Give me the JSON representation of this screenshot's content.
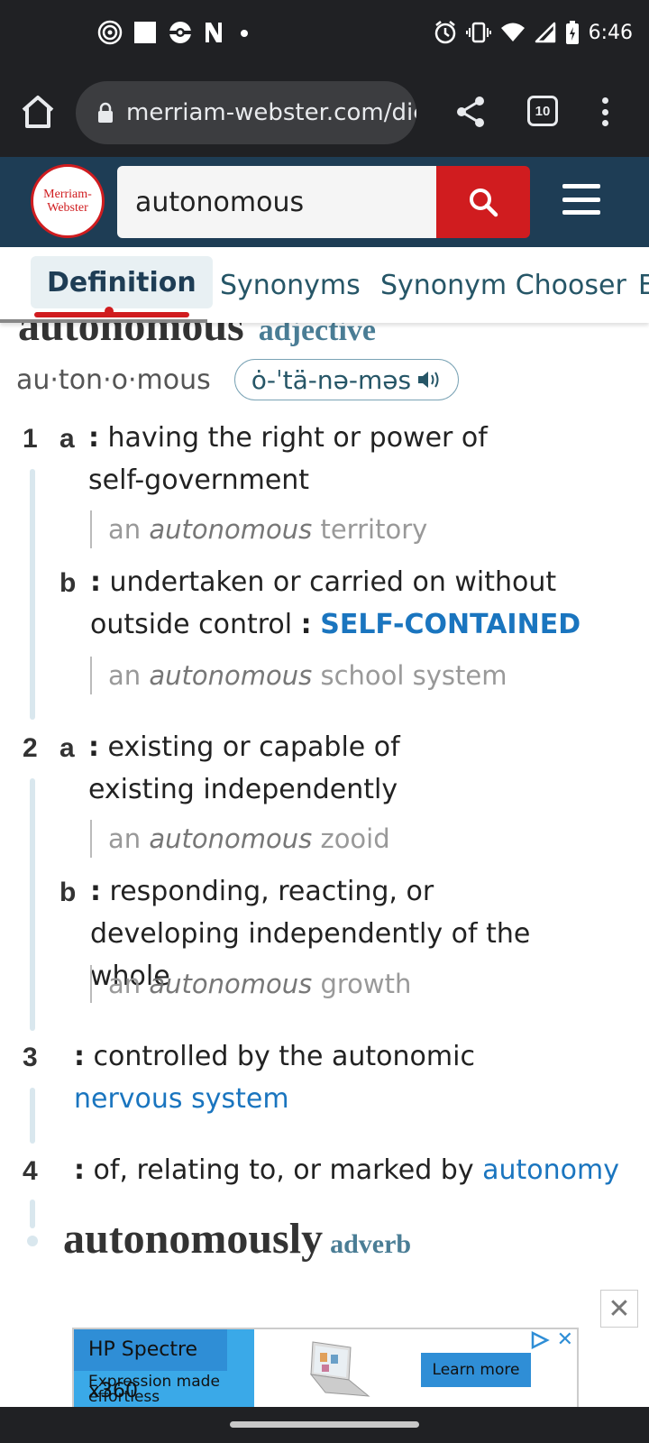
{
  "status_bar": {
    "time": "6:46",
    "left_icons": [
      "hotspot-icon",
      "square-icon",
      "pokeball-icon",
      "notion-icon",
      "dot-icon"
    ],
    "right_icons": [
      "alarm-icon",
      "vibrate-icon",
      "wifi-icon",
      "signal-icon",
      "battery-icon"
    ]
  },
  "browser": {
    "url": "merriam-webster.com/dic",
    "tab_count": "10"
  },
  "site": {
    "logo_line1": "Merriam-",
    "logo_line2": "Webster",
    "search_value": "autonomous",
    "accent": "#d01c1f",
    "header_bg": "#1e3d55"
  },
  "tabs": [
    {
      "label": "Definition",
      "active": true
    },
    {
      "label": "Synonyms"
    },
    {
      "label": "Synonym Chooser"
    },
    {
      "label": "E"
    }
  ],
  "entry": {
    "headword_clipped": "autonomous",
    "pos_clipped": "adjective",
    "syllables": "au·ton·o·mous",
    "pronunciation": "ȯ-ˈtä-nə-məs",
    "senses": [
      {
        "num": "1",
        "letter": "a",
        "colon": ":",
        "text": "having the right or power of self-government",
        "vis_pre": "an",
        "vis_word": "autonomous",
        "vis_post": "territory"
      },
      {
        "num": "",
        "letter": "b",
        "colon": ":",
        "text": "undertaken or carried on without outside control",
        "colon2": ":",
        "sc": "SELF-CONTAINED",
        "vis_pre": "an",
        "vis_word": "autonomous",
        "vis_post": "school system"
      },
      {
        "num": "2",
        "letter": "a",
        "colon": ":",
        "text": "existing or capable of existing independently",
        "vis_pre": "an",
        "vis_word": "autonomous",
        "vis_post": "zooid"
      },
      {
        "num": "",
        "letter": "b",
        "colon": ":",
        "text": "responding, reacting, or developing independently of the whole",
        "vis_pre": "an",
        "vis_word": "autonomous",
        "vis_post": "growth"
      },
      {
        "num": "3",
        "colon": ":",
        "text": "controlled by the autonomic",
        "link": "nervous system"
      },
      {
        "num": "4",
        "colon": ":",
        "text": "of, relating to, or marked by",
        "link": "autonomy"
      }
    ],
    "run_on": "autonomously",
    "run_on_pos": "adverb"
  },
  "ad": {
    "brand": "HP Spectre x360",
    "tagline": "Expression made effortless",
    "cta": "Learn more"
  }
}
